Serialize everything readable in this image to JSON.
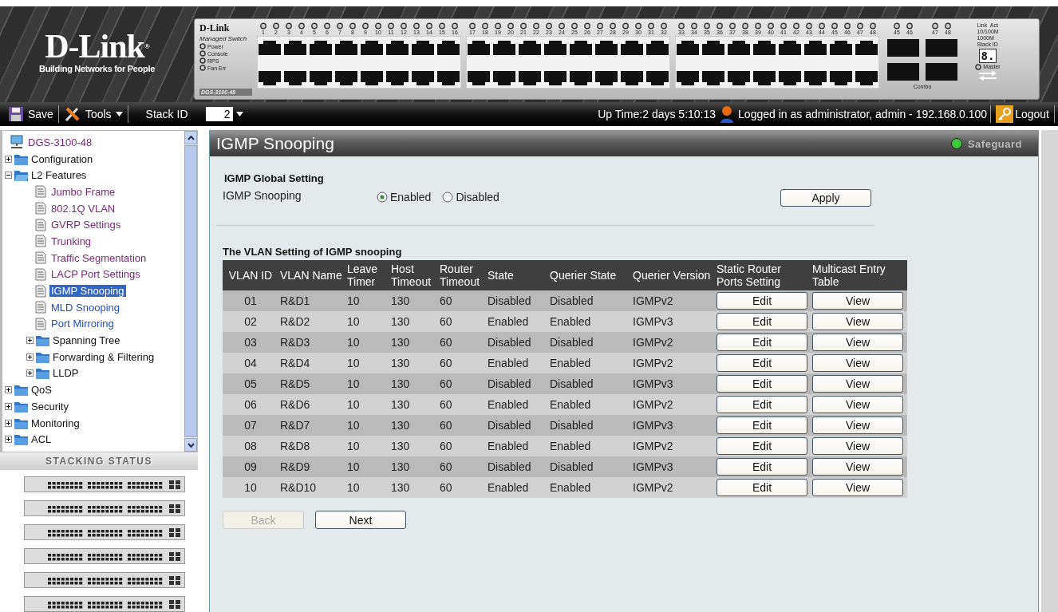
{
  "banner": {
    "logo": {
      "name": "D-Link",
      "mark": "®",
      "tagline": "Building Networks for People"
    },
    "device": {
      "brand": "D-Link",
      "subtitle": "Managed Switch",
      "model": "DGS-3100-48",
      "leds": [
        "Power",
        "Console",
        "RPS",
        "Fan Err"
      ],
      "port_groups": [
        {
          "ports": [
            "1",
            "2",
            "3",
            "4",
            "5",
            "6",
            "7",
            "8",
            "9",
            "10",
            "11",
            "12",
            "13",
            "14",
            "15",
            "16"
          ]
        },
        {
          "ports": [
            "17",
            "18",
            "19",
            "20",
            "21",
            "22",
            "23",
            "24",
            "25",
            "26",
            "27",
            "28",
            "29",
            "30",
            "31",
            "32"
          ]
        },
        {
          "ports": [
            "33",
            "34",
            "35",
            "36",
            "37",
            "38",
            "39",
            "40",
            "41",
            "42",
            "43",
            "44",
            "45",
            "46",
            "47",
            "48"
          ]
        }
      ],
      "combo": {
        "ports": [
          "45",
          "46",
          "47",
          "48"
        ],
        "label": "Combo"
      },
      "legend": [
        "Link",
        "Act",
        "10/100M",
        "1000M",
        "Stack ID"
      ],
      "stack_digit": "8.",
      "master": "Master"
    }
  },
  "toolbar": {
    "save": "Save",
    "tools": "Tools",
    "stack_id_label": "Stack ID",
    "stack_id_value": "2",
    "uptime": "Up Time:2 days 5:10:13",
    "login": "Logged in as administrator, admin - 192.168.0.100",
    "logout": "Logout"
  },
  "sidebar": {
    "tree": [
      {
        "label": "DGS-3100-48",
        "kind": "device",
        "selected": false
      },
      {
        "label": "Configuration",
        "kind": "folder",
        "expanded": false,
        "selected": false
      },
      {
        "label": "L2 Features",
        "kind": "folder",
        "expanded": true,
        "selected": false,
        "children": [
          {
            "label": "Jumbo Frame",
            "kind": "page",
            "visited": true,
            "selected": false
          },
          {
            "label": "802.1Q VLAN",
            "kind": "page",
            "visited": true,
            "selected": false
          },
          {
            "label": "GVRP Settings",
            "kind": "page",
            "visited": true,
            "selected": false
          },
          {
            "label": "Trunking",
            "kind": "page",
            "visited": true,
            "selected": false
          },
          {
            "label": "Traffic Segmentation",
            "kind": "page",
            "visited": true,
            "selected": false
          },
          {
            "label": "LACP Port Settings",
            "kind": "page",
            "visited": true,
            "selected": false
          },
          {
            "label": "IGMP Snooping",
            "kind": "page",
            "visited": false,
            "selected": true
          },
          {
            "label": "MLD Snooping",
            "kind": "page",
            "visited": false,
            "selected": false
          },
          {
            "label": "Port Mirroring",
            "kind": "page",
            "visited": false,
            "selected": false
          },
          {
            "label": "Spanning Tree",
            "kind": "folder",
            "expanded": false,
            "selected": false
          },
          {
            "label": "Forwarding & Filtering",
            "kind": "folder",
            "expanded": false,
            "selected": false
          },
          {
            "label": "LLDP",
            "kind": "folder",
            "expanded": false,
            "selected": false
          }
        ]
      },
      {
        "label": "QoS",
        "kind": "folder",
        "expanded": false,
        "selected": false
      },
      {
        "label": "Security",
        "kind": "folder",
        "expanded": false,
        "selected": false
      },
      {
        "label": "Monitoring",
        "kind": "folder",
        "expanded": false,
        "selected": false
      },
      {
        "label": "ACL",
        "kind": "folder",
        "expanded": false,
        "selected": false
      }
    ],
    "stacking_status": {
      "title": "STACKING STATUS",
      "units": [
        {
          "kind": "switch"
        },
        {
          "kind": "switch"
        },
        {
          "kind": "switch"
        },
        {
          "kind": "switch"
        },
        {
          "kind": "switch"
        },
        {
          "kind": "switch"
        }
      ]
    }
  },
  "page": {
    "title": "IGMP Snooping",
    "safeguard": {
      "label": "Safeguard",
      "on": true
    },
    "global_setting": {
      "title": "IGMP Global Setting",
      "label": "IGMP Snooping",
      "options": [
        {
          "label": "Enabled",
          "selected": true
        },
        {
          "label": "Disabled",
          "selected": false
        }
      ],
      "apply": "Apply"
    },
    "vlan_table": {
      "title": "The VLAN Setting of IGMP snooping",
      "columns": [
        "VLAN ID",
        "VLAN Name",
        "Leave Timer",
        "Host Timeout",
        "Router Timeout",
        "State",
        "Querier State",
        "Querier Version",
        "Static Router Ports Setting",
        "Multicast Entry Table"
      ],
      "rows": [
        {
          "cells": [
            "01",
            "R&D1",
            "10",
            "130",
            "60",
            "Disabled",
            "Disabled",
            "IGMPv2"
          ],
          "actions": [
            "Edit",
            "View"
          ]
        },
        {
          "cells": [
            "02",
            "R&D2",
            "10",
            "130",
            "60",
            "Enabled",
            "Enabled",
            "IGMPv3"
          ],
          "actions": [
            "Edit",
            "View"
          ]
        },
        {
          "cells": [
            "03",
            "R&D3",
            "10",
            "130",
            "60",
            "Disabled",
            "Disabled",
            "IGMPv2"
          ],
          "actions": [
            "Edit",
            "View"
          ]
        },
        {
          "cells": [
            "04",
            "R&D4",
            "10",
            "130",
            "60",
            "Enabled",
            "Enabled",
            "IGMPv2"
          ],
          "actions": [
            "Edit",
            "View"
          ]
        },
        {
          "cells": [
            "05",
            "R&D5",
            "10",
            "130",
            "60",
            "Disabled",
            "Disabled",
            "IGMPv3"
          ],
          "actions": [
            "Edit",
            "View"
          ]
        },
        {
          "cells": [
            "06",
            "R&D6",
            "10",
            "130",
            "60",
            "Enabled",
            "Enabled",
            "IGMPv2"
          ],
          "actions": [
            "Edit",
            "View"
          ]
        },
        {
          "cells": [
            "07",
            "R&D7",
            "10",
            "130",
            "60",
            "Disabled",
            "Disabled",
            "IGMPv3"
          ],
          "actions": [
            "Edit",
            "View"
          ]
        },
        {
          "cells": [
            "08",
            "R&D8",
            "10",
            "130",
            "60",
            "Enabled",
            "Enabled",
            "IGMPv2"
          ],
          "actions": [
            "Edit",
            "View"
          ]
        },
        {
          "cells": [
            "09",
            "R&D9",
            "10",
            "130",
            "60",
            "Disabled",
            "Disabled",
            "IGMPv3"
          ],
          "actions": [
            "Edit",
            "View"
          ]
        },
        {
          "cells": [
            "10",
            "R&D10",
            "10",
            "130",
            "60",
            "Enabled",
            "Enabled",
            "IGMPv2"
          ],
          "actions": [
            "Edit",
            "View"
          ]
        }
      ]
    },
    "pager": [
      {
        "label": "Back",
        "disabled": true
      },
      {
        "label": "Next",
        "disabled": false
      }
    ]
  }
}
